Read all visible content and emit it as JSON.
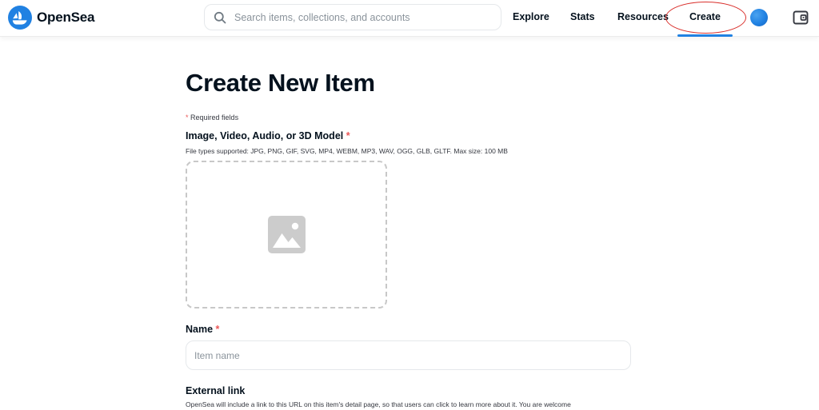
{
  "header": {
    "brand": "OpenSea",
    "search": {
      "placeholder": "Search items, collections, and accounts",
      "value": ""
    },
    "nav": {
      "explore": "Explore",
      "stats": "Stats",
      "resources": "Resources",
      "create": "Create"
    },
    "icons": {
      "logo": "opensea-logo-icon",
      "search": "search-icon",
      "avatar": "avatar",
      "wallet": "wallet-icon"
    }
  },
  "main": {
    "title": "Create New Item",
    "required_note": {
      "asterisk": "*",
      "text": "Required fields"
    },
    "media_field": {
      "label": "Image, Video, Audio, or 3D Model",
      "required_mark": "*",
      "hint": "File types supported: JPG, PNG, GIF, SVG, MP4, WEBM, MP3, WAV, OGG, GLB, GLTF. Max size: 100 MB",
      "upload_icon": "image-placeholder-icon"
    },
    "name_field": {
      "label": "Name",
      "required_mark": "*",
      "placeholder": "Item name",
      "value": ""
    },
    "external_link_field": {
      "label": "External link",
      "hint": "OpenSea will include a link to this URL on this item's detail page, so that users can click to learn more about it. You are welcome"
    }
  },
  "colors": {
    "brand_blue": "#2081e2",
    "text_primary": "#04111d",
    "required_red": "#eb5757",
    "annotation_red": "#d9302c",
    "placeholder_gray": "#8a939b"
  }
}
